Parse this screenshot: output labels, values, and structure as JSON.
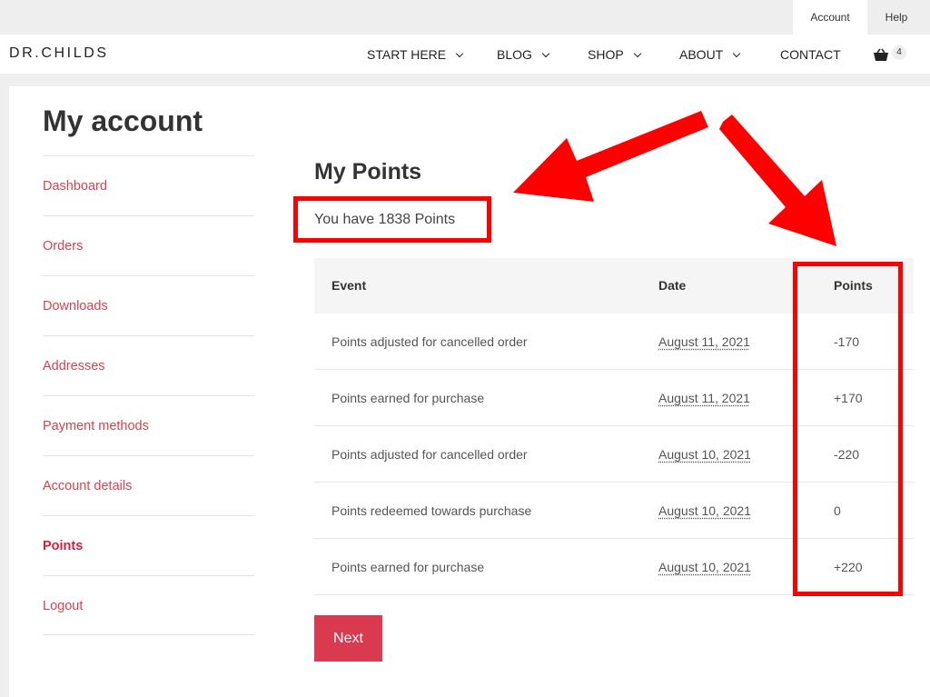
{
  "topbar": {
    "account_label": "Account",
    "help_label": "Help"
  },
  "header": {
    "logo": "DR.CHILDS",
    "nav": [
      {
        "label": "START HERE",
        "has_dropdown": true
      },
      {
        "label": "BLOG",
        "has_dropdown": true
      },
      {
        "label": "SHOP",
        "has_dropdown": true
      },
      {
        "label": "ABOUT",
        "has_dropdown": true
      },
      {
        "label": "CONTACT",
        "has_dropdown": false
      }
    ],
    "cart_count": "4",
    "cart_icon": "basket-icon"
  },
  "page": {
    "title": "My account",
    "sidebar": [
      {
        "label": "Dashboard"
      },
      {
        "label": "Orders"
      },
      {
        "label": "Downloads"
      },
      {
        "label": "Addresses"
      },
      {
        "label": "Payment methods"
      },
      {
        "label": "Account details"
      },
      {
        "label": "Points",
        "active": true
      },
      {
        "label": "Logout"
      }
    ],
    "section_title": "My Points",
    "balance_text": "You have 1838 Points",
    "table": {
      "headers": {
        "event": "Event",
        "date": "Date",
        "points": "Points"
      },
      "rows": [
        {
          "event": "Points adjusted for cancelled order",
          "date": "August 11, 2021",
          "points": "-170"
        },
        {
          "event": "Points earned for purchase",
          "date": "August 11, 2021",
          "points": "+170"
        },
        {
          "event": "Points adjusted for cancelled order",
          "date": "August 10, 2021",
          "points": "-220"
        },
        {
          "event": "Points redeemed towards purchase",
          "date": "August 10, 2021",
          "points": "0"
        },
        {
          "event": "Points earned for purchase",
          "date": "August 10, 2021",
          "points": "+220"
        }
      ]
    },
    "next_label": "Next"
  },
  "colors": {
    "accent": "#d93a4f",
    "link": "#d9424e",
    "annotation": "#ff0000"
  }
}
